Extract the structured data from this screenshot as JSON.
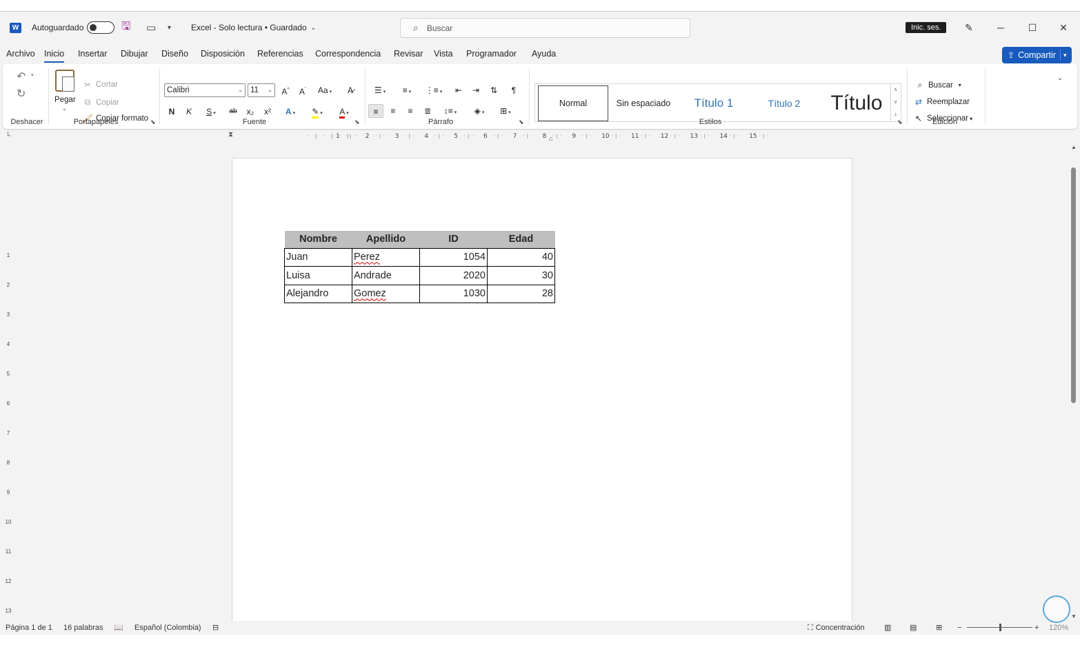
{
  "titlebar": {
    "autosave_label": "Autoguardado",
    "doc_title": "Excel  -  Solo lectura  •  Guardado",
    "search_placeholder": "Buscar",
    "signin_label": "Inic. ses.",
    "minimize": "─",
    "maximize": "☐",
    "close": "✕"
  },
  "menu": {
    "tabs": [
      "Archivo",
      "Inicio",
      "Insertar",
      "Dibujar",
      "Diseño",
      "Disposición",
      "Referencias",
      "Correspondencia",
      "Revisar",
      "Vista",
      "Programador",
      "Ayuda"
    ],
    "active": "Inicio",
    "share_label": "Compartir"
  },
  "ribbon": {
    "groups": {
      "undo": "Deshacer",
      "clipboard": "Portapapeles",
      "font": "Fuente",
      "paragraph": "Párrafo",
      "styles": "Estilos",
      "editing": "Edición"
    },
    "clipboard": {
      "paste": "Pegar",
      "cut": "Cortar",
      "copy": "Copiar",
      "format_painter": "Copiar formato"
    },
    "font": {
      "family": "Calibri",
      "size": "11",
      "bold": "N",
      "italic": "K",
      "underline": "S",
      "strike": "ab",
      "subscript": "x₂",
      "superscript": "x²",
      "grow": "A^",
      "shrink": "Aˇ",
      "case": "Aa",
      "font_color": "A",
      "text_effects": "A"
    },
    "styles": [
      "Normal",
      "Sin espaciado",
      "Título 1",
      "Título 2",
      "Título"
    ],
    "editing": {
      "find": "Buscar",
      "replace": "Reemplazar",
      "select": "Seleccionar"
    }
  },
  "ruler": {
    "horizontal": [
      "1",
      "2",
      "3",
      "4",
      "5",
      "6",
      "7",
      "8",
      "9",
      "10",
      "11",
      "12",
      "13",
      "14",
      "15"
    ],
    "vertical": [
      "1",
      "2",
      "3",
      "4",
      "5",
      "6",
      "7",
      "8",
      "9",
      "10",
      "11",
      "12",
      "13"
    ]
  },
  "table": {
    "headers": [
      "Nombre",
      "Apellido",
      "ID",
      "Edad"
    ],
    "rows": [
      [
        "Juan",
        "Perez",
        "1054",
        "40"
      ],
      [
        "Luisa",
        "Andrade",
        "2020",
        "30"
      ],
      [
        "Alejandro",
        "Gomez",
        "1030",
        "28"
      ]
    ]
  },
  "status": {
    "page": "Página 1 de 1",
    "words": "16 palabras",
    "language": "Español (Colombia)",
    "focus": "Concentración",
    "zoom_minus": "−",
    "zoom_plus": "+",
    "zoom": "120%"
  },
  "colors": {
    "accent": "#185abd",
    "table_header_bg": "#bfbfbf",
    "heading_blue": "#2e74b5"
  }
}
